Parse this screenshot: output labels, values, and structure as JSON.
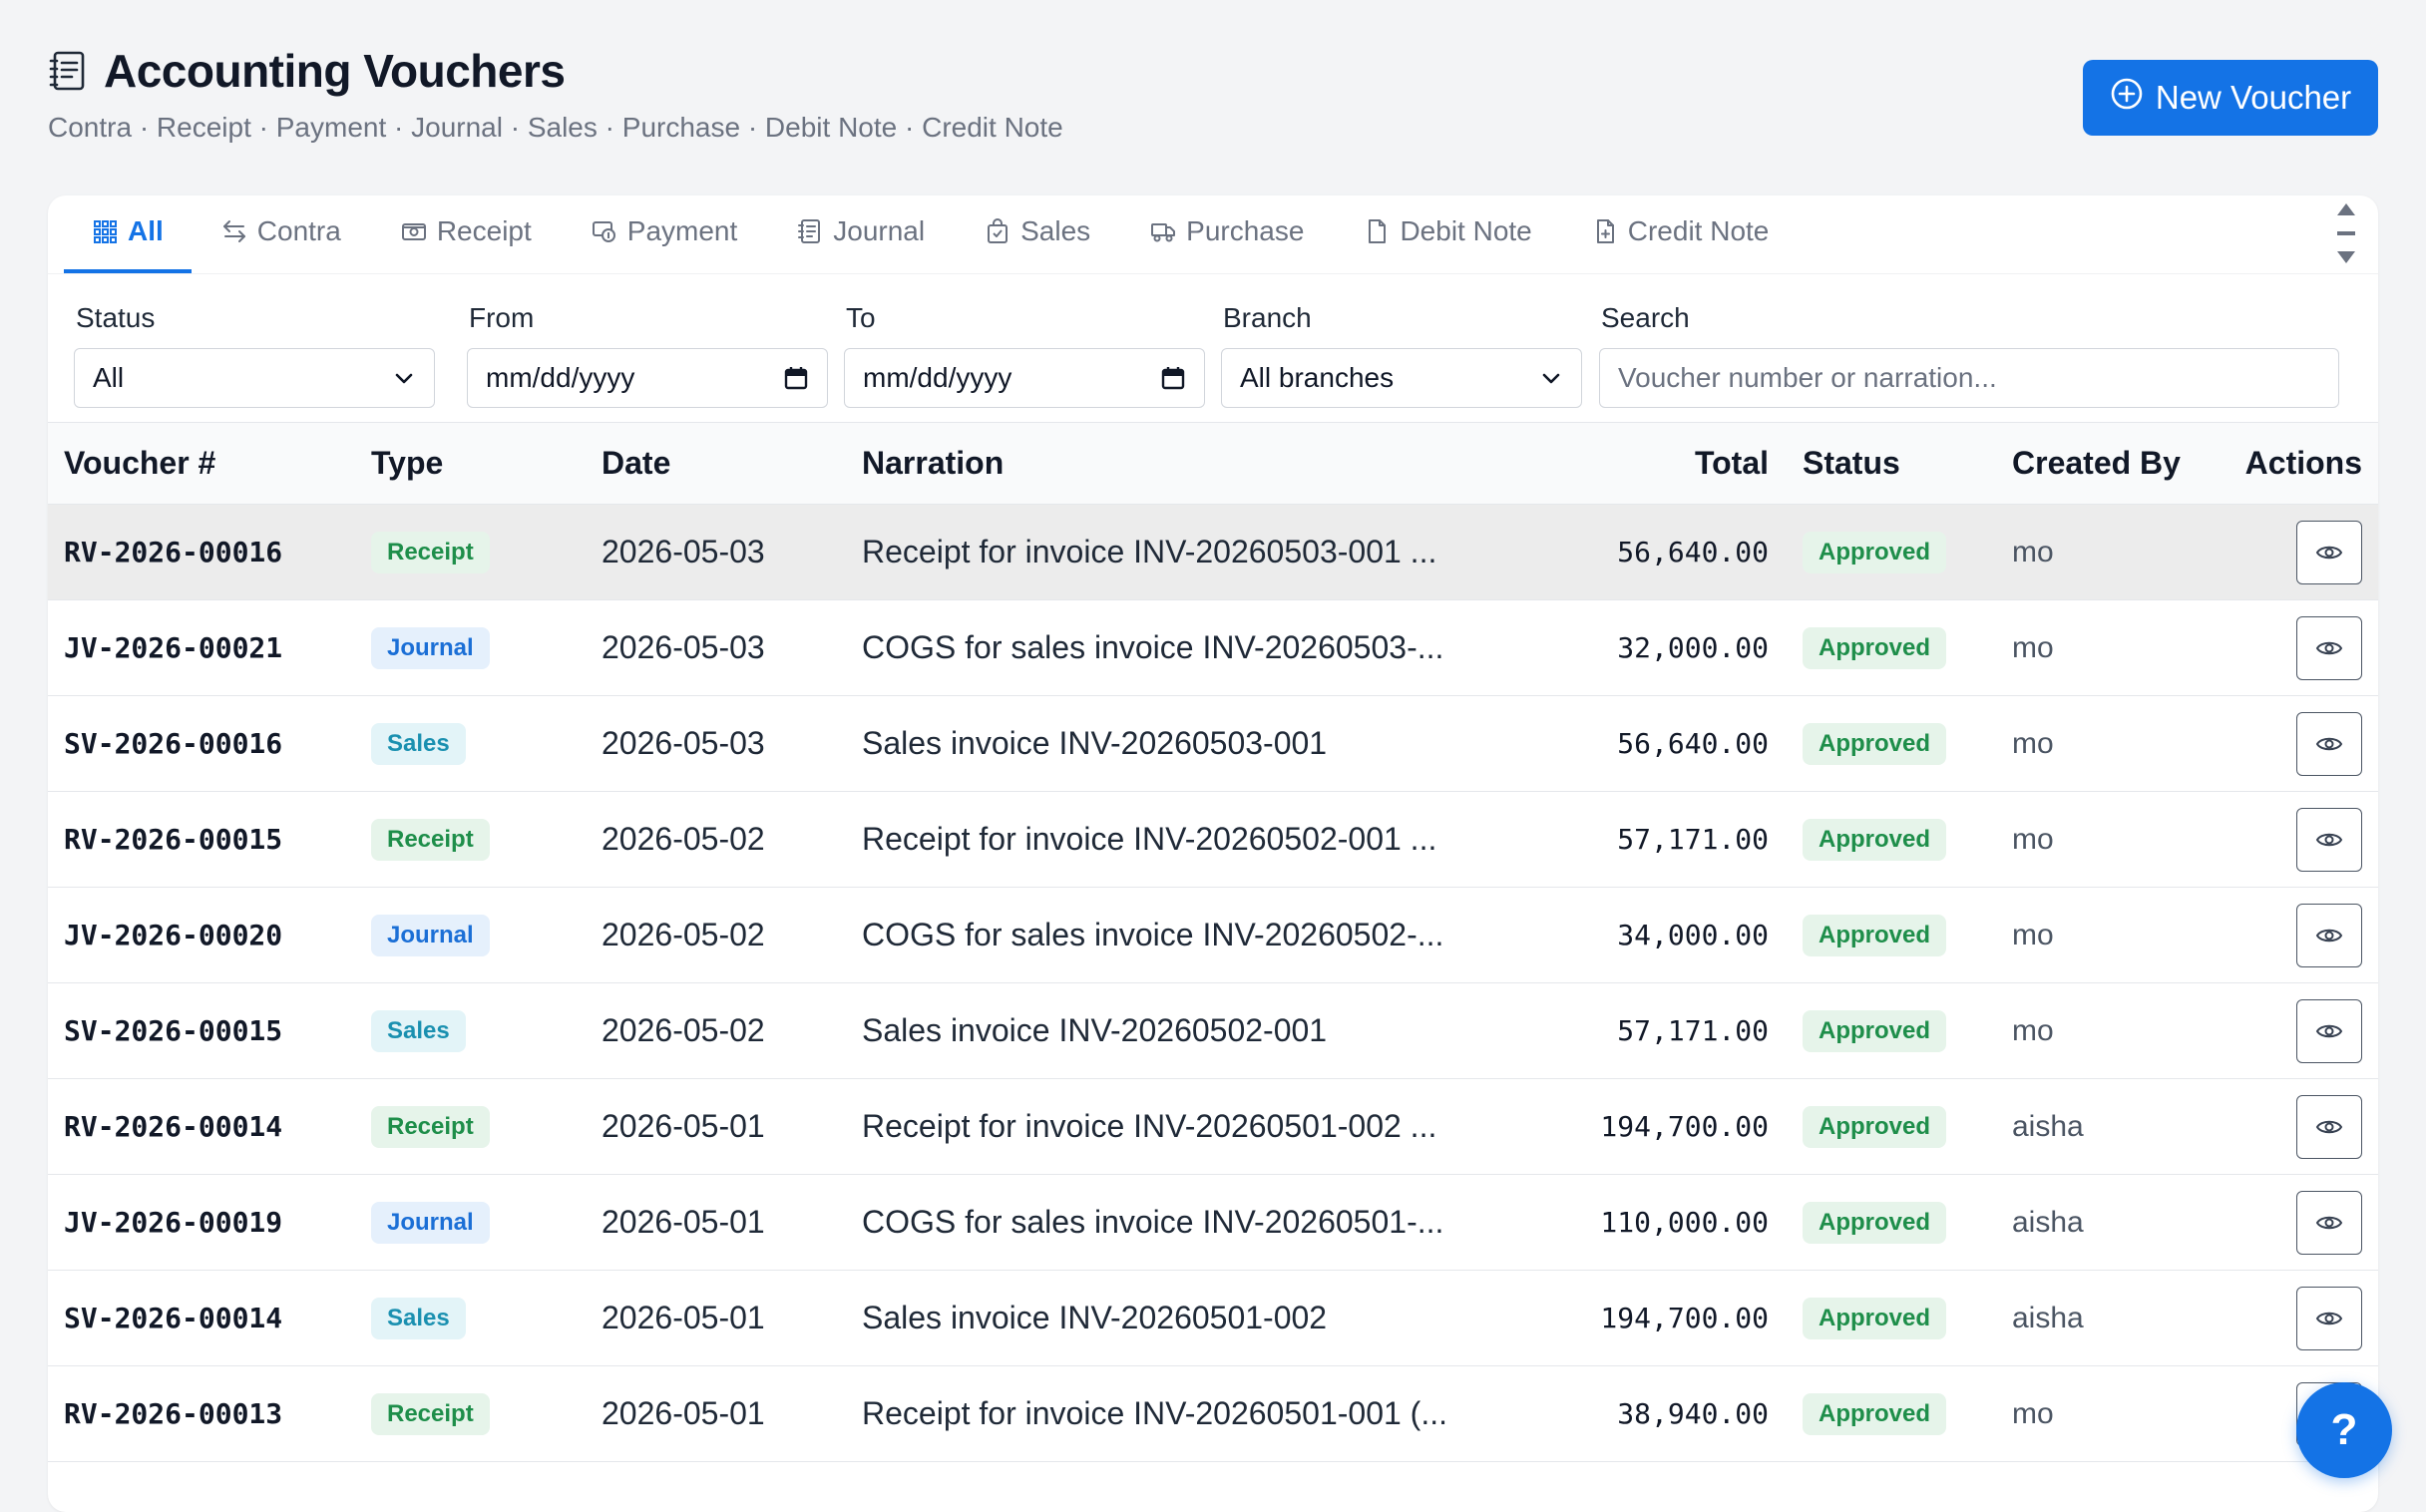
{
  "page": {
    "title": "Accounting Vouchers",
    "subtitle": "Contra · Receipt · Payment · Journal · Sales · Purchase · Debit Note · Credit Note",
    "new_button": "New Voucher"
  },
  "tabs": [
    {
      "label": "All",
      "icon": "grid-icon",
      "active": true
    },
    {
      "label": "Contra",
      "icon": "swap-icon"
    },
    {
      "label": "Receipt",
      "icon": "cash-icon"
    },
    {
      "label": "Payment",
      "icon": "payment-icon"
    },
    {
      "label": "Journal",
      "icon": "journal-icon"
    },
    {
      "label": "Sales",
      "icon": "bag-icon"
    },
    {
      "label": "Purchase",
      "icon": "truck-icon"
    },
    {
      "label": "Debit Note",
      "icon": "document-icon"
    },
    {
      "label": "Credit Note",
      "icon": "document-plus-icon"
    }
  ],
  "filters": {
    "status": {
      "label": "Status",
      "value": "All"
    },
    "from": {
      "label": "From",
      "value": "mm/dd/yyyy"
    },
    "to": {
      "label": "To",
      "value": "mm/dd/yyyy"
    },
    "branch": {
      "label": "Branch",
      "value": "All branches"
    },
    "search": {
      "label": "Search",
      "placeholder": "Voucher number or narration..."
    }
  },
  "table": {
    "headers": {
      "voucher": "Voucher #",
      "type": "Type",
      "date": "Date",
      "narration": "Narration",
      "total": "Total",
      "status": "Status",
      "created_by": "Created By",
      "actions": "Actions"
    },
    "rows": [
      {
        "voucher": "RV-2026-00016",
        "type": "Receipt",
        "date": "2026-05-03",
        "narration": "Receipt for invoice INV-20260503-001 ...",
        "total": "56,640.00",
        "status": "Approved",
        "created_by": "mo"
      },
      {
        "voucher": "JV-2026-00021",
        "type": "Journal",
        "date": "2026-05-03",
        "narration": "COGS for sales invoice INV-20260503-...",
        "total": "32,000.00",
        "status": "Approved",
        "created_by": "mo"
      },
      {
        "voucher": "SV-2026-00016",
        "type": "Sales",
        "date": "2026-05-03",
        "narration": "Sales invoice INV-20260503-001",
        "total": "56,640.00",
        "status": "Approved",
        "created_by": "mo"
      },
      {
        "voucher": "RV-2026-00015",
        "type": "Receipt",
        "date": "2026-05-02",
        "narration": "Receipt for invoice INV-20260502-001 ...",
        "total": "57,171.00",
        "status": "Approved",
        "created_by": "mo"
      },
      {
        "voucher": "JV-2026-00020",
        "type": "Journal",
        "date": "2026-05-02",
        "narration": "COGS for sales invoice INV-20260502-...",
        "total": "34,000.00",
        "status": "Approved",
        "created_by": "mo"
      },
      {
        "voucher": "SV-2026-00015",
        "type": "Sales",
        "date": "2026-05-02",
        "narration": "Sales invoice INV-20260502-001",
        "total": "57,171.00",
        "status": "Approved",
        "created_by": "mo"
      },
      {
        "voucher": "RV-2026-00014",
        "type": "Receipt",
        "date": "2026-05-01",
        "narration": "Receipt for invoice INV-20260501-002 ...",
        "total": "194,700.00",
        "status": "Approved",
        "created_by": "aisha"
      },
      {
        "voucher": "JV-2026-00019",
        "type": "Journal",
        "date": "2026-05-01",
        "narration": "COGS for sales invoice INV-20260501-...",
        "total": "110,000.00",
        "status": "Approved",
        "created_by": "aisha"
      },
      {
        "voucher": "SV-2026-00014",
        "type": "Sales",
        "date": "2026-05-01",
        "narration": "Sales invoice INV-20260501-002",
        "total": "194,700.00",
        "status": "Approved",
        "created_by": "aisha"
      },
      {
        "voucher": "RV-2026-00013",
        "type": "Receipt",
        "date": "2026-05-01",
        "narration": "Receipt for invoice INV-20260501-001 (...",
        "total": "38,940.00",
        "status": "Approved",
        "created_by": "mo"
      }
    ]
  },
  "help_button": "?",
  "colors": {
    "accent": "#1473e6",
    "approved": "#1e8e4a"
  }
}
